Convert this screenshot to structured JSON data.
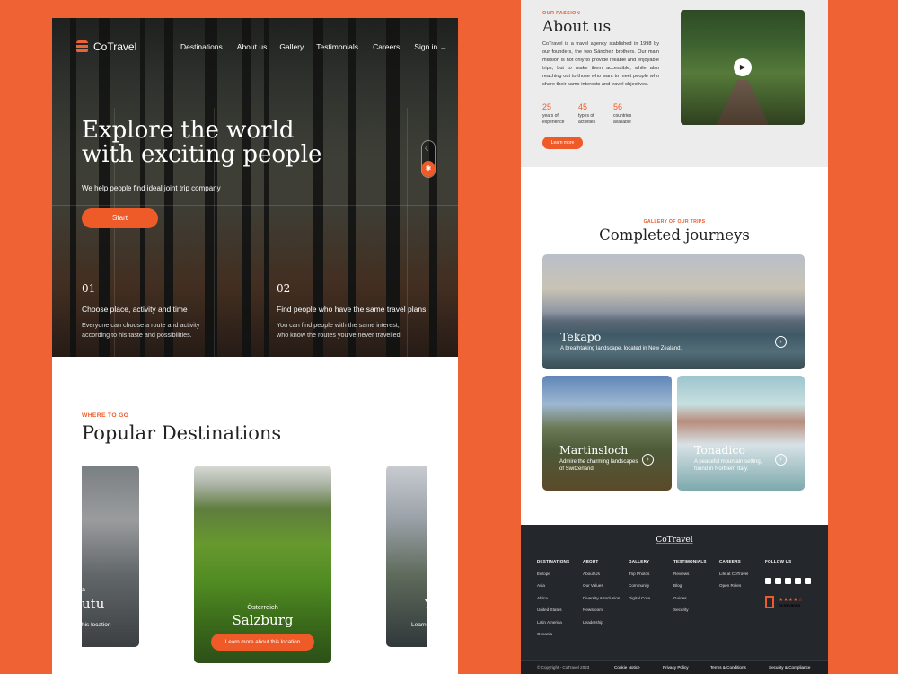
{
  "brand": {
    "name": "CoTravel"
  },
  "nav": {
    "items": [
      "Destinations",
      "About us",
      "Gallery",
      "Testimonials",
      "Careers",
      "Sign in →"
    ]
  },
  "hero": {
    "title_line1": "Explore the world",
    "title_line2": "with exciting people",
    "subtitle": "We help people find ideal joint trip company",
    "cta": "Start",
    "steps": [
      {
        "num": "01",
        "title": "Choose place, activity and time",
        "desc": "Everyone can choose a route and activity according to his taste and possibilities."
      },
      {
        "num": "02",
        "title": "Find people who have the same travel plans",
        "desc": "You can find people with the same interest, who know the routes you've never travelled."
      }
    ]
  },
  "destinations": {
    "eyebrow": "WHERE TO GO",
    "title": "Popular Destinations",
    "cards": [
      {
        "country": "a",
        "name": "utu",
        "cta": "his location"
      },
      {
        "country": "Österreich",
        "name": "Salzburg",
        "cta": "Learn more about this location"
      },
      {
        "country": "",
        "name": "Y",
        "cta": "Learn"
      }
    ]
  },
  "about": {
    "eyebrow": "OUR PASSION",
    "title": "About us",
    "text": "CoTravel is a travel agency stablished in 1998 by our founders, the two Sánchez brothers. Our main mission is not only to provide reliable and enjoyable trips, but to make them accessible, while also reaching out to those who want to meet people who share their same interests and travel objectives.",
    "stats": [
      {
        "value": "25",
        "label1": "years of",
        "label2": "experience"
      },
      {
        "value": "45",
        "label1": "types of",
        "label2": "activities"
      },
      {
        "value": "56",
        "label1": "countries",
        "label2": "available"
      }
    ],
    "cta": "Learn more"
  },
  "gallery": {
    "eyebrow": "GALLERY OF OUR TRIPS",
    "title": "Completed journeys",
    "trips": [
      {
        "name": "Tekapo",
        "desc": "A breathtaking landscape, located in New Zealand."
      },
      {
        "name": "Martinsloch",
        "desc1": "Admire the charming landscapes",
        "desc2": "of Switzerland."
      },
      {
        "name": "Tonadico",
        "desc1": "A peaceful mountain setting,",
        "desc2": "found in Northern Italy."
      }
    ]
  },
  "footer": {
    "logo": "CoTravel",
    "columns": [
      {
        "title": "DESTINATIONS",
        "items": [
          "Europe",
          "Asia",
          "Africa",
          "United States",
          "Latin America",
          "Oceania"
        ]
      },
      {
        "title": "ABOUT",
        "items": [
          "About Us",
          "Our Values",
          "Diversity & Inclusion",
          "Newsroom",
          "Leadership"
        ]
      },
      {
        "title": "GALLERY",
        "items": [
          "Trip Photos",
          "Community",
          "Digital Core"
        ]
      },
      {
        "title": "TESTIMONIALS",
        "items": [
          "Reviews",
          "Blog",
          "Guides",
          "Security"
        ]
      },
      {
        "title": "CAREERS",
        "items": [
          "Life at CoTravel",
          "Open Roles"
        ]
      }
    ],
    "follow": "FOLLOW US",
    "social_icons": [
      "twitter-icon",
      "facebook-icon",
      "instagram-icon",
      "youtube-icon",
      "linkedin-icon"
    ],
    "rating_stars": "★★★★☆",
    "reviews": "78 REVIEWS",
    "bottom": {
      "copyright": "© Copyright - CoTravel 2023",
      "links": [
        "Cookie Notice",
        "Privacy Policy",
        "Terms & Conditions",
        "Security & Compliance"
      ]
    }
  }
}
